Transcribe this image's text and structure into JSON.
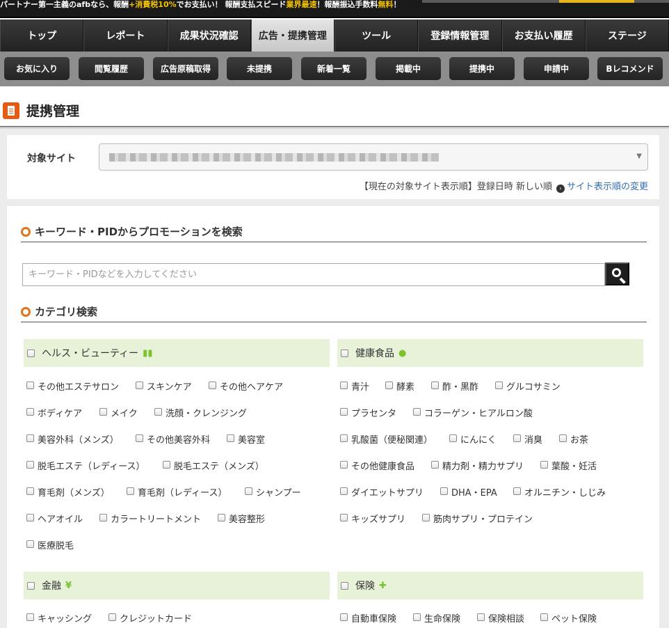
{
  "promo_bar": {
    "part1": "パートナー第一主義のafbなら、報酬",
    "part2": "+消費税10%",
    "part3": "でお支払い！ 報酬支払スピード",
    "part4": "業界最速",
    "part5": "！報酬振込手数料",
    "part6": "無料",
    "part7": "！"
  },
  "main_nav": [
    {
      "label": "トップ"
    },
    {
      "label": "レポート"
    },
    {
      "label": "成果状況確認"
    },
    {
      "label": "広告・提携管理",
      "active": true
    },
    {
      "label": "ツール"
    },
    {
      "label": "登録情報管理"
    },
    {
      "label": "お支払い履歴"
    },
    {
      "label": "ステージ"
    }
  ],
  "sub_nav": [
    {
      "label": "お気に入り"
    },
    {
      "label": "閲覧履歴"
    },
    {
      "label": "広告原稿取得"
    },
    {
      "label": "未提携"
    },
    {
      "label": "新着一覧"
    },
    {
      "label": "掲載中"
    },
    {
      "label": "提携中"
    },
    {
      "label": "申請中"
    },
    {
      "label": "Bレコメンド"
    }
  ],
  "page": {
    "title": "提携管理"
  },
  "site": {
    "label": "対象サイト",
    "order_text": "【現在の対象サイト表示順】登録日時 新しい順",
    "order_link": "サイト表示順の変更"
  },
  "keyword_search": {
    "title": "キーワード・PIDからプロモーションを検索",
    "placeholder": "キーワード・PIDなどを入力してください"
  },
  "category_search": {
    "title": "カテゴリ検索",
    "health_beauty": {
      "name": "ヘルス・ビューティー",
      "icon": "bottles-icon",
      "items": [
        "その他エステサロン",
        "スキンケア",
        "その他ヘアケア",
        "ボディケア",
        "メイク",
        "洗顔・クレンジング",
        "美容外科（メンズ）",
        "その他美容外科",
        "美容室",
        "脱毛エステ（レディース）",
        "脱毛エステ（メンズ）",
        "育毛剤（メンズ）",
        "育毛剤（レディース）",
        "シャンプー",
        "ヘアオイル",
        "カラートリートメント",
        "美容整形",
        "医療脱毛"
      ]
    },
    "health_food": {
      "name": "健康食品",
      "icon": "apple-icon",
      "items": [
        "青汁",
        "酵素",
        "酢・黒酢",
        "グルコサミン",
        "プラセンタ",
        "コラーゲン・ヒアルロン酸",
        "乳酸菌（便秘関連）",
        "にんにく",
        "消臭",
        "お茶",
        "その他健康食品",
        "精力剤・精力サプリ",
        "葉酸・妊活",
        "ダイエットサプリ",
        "DHA・EPA",
        "オルニチン・しじみ",
        "キッズサプリ",
        "筋肉サプリ・プロテイン"
      ]
    },
    "finance": {
      "name": "金融",
      "icon_glyph": "¥",
      "items": [
        "キャッシング",
        "クレジットカード"
      ]
    },
    "insurance": {
      "name": "保険",
      "icon": "first-aid-icon",
      "items": [
        "自動車保険",
        "生命保険",
        "保険相談",
        "ペット保険"
      ]
    }
  },
  "colors": {
    "accent_orange": "#e5731a",
    "category_bg": "#e7f2d8",
    "icon_green": "#7cc22c",
    "link_blue": "#336fb5"
  }
}
